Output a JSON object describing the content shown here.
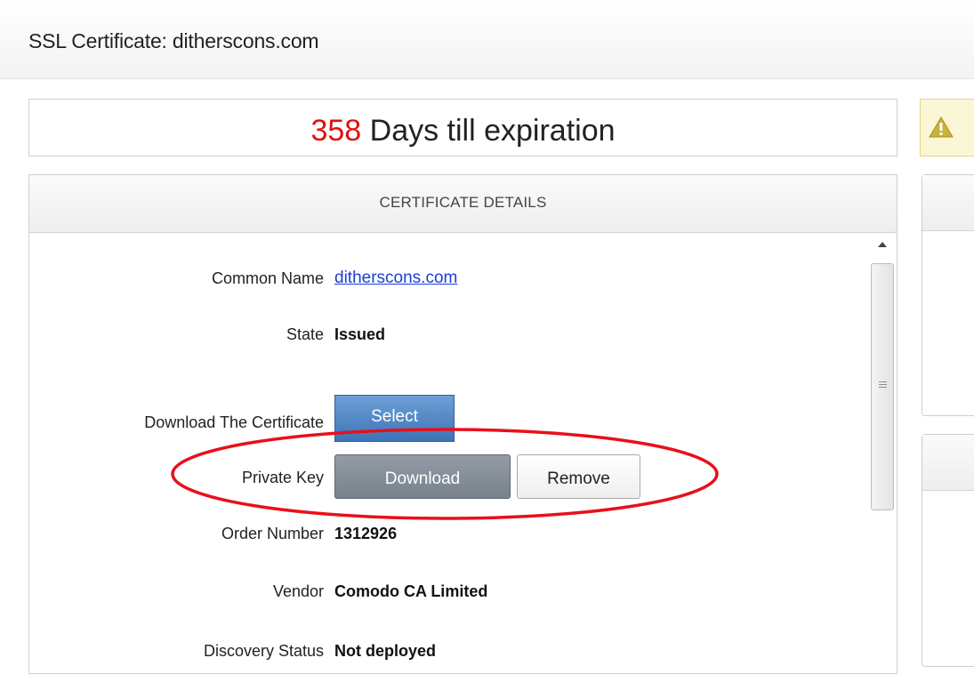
{
  "window": {
    "title": "SSL Certificate: ditherscons.com"
  },
  "expiry": {
    "days": "358",
    "label": " Days till expiration"
  },
  "panel": {
    "header": "CERTIFICATE DETAILS"
  },
  "fields": {
    "common_name": {
      "label": "Common Name",
      "value": "ditherscons.com"
    },
    "state": {
      "label": "State",
      "value": "Issued"
    },
    "download_certificate": {
      "label": "Download The Certificate",
      "button": "Select"
    },
    "private_key": {
      "label": "Private Key",
      "download_button": "Download",
      "remove_button": "Remove"
    },
    "order_number": {
      "label": "Order Number",
      "value": "1312926"
    },
    "vendor": {
      "label": "Vendor",
      "value": "Comodo CA Limited"
    },
    "discovery_status": {
      "label": "Discovery Status",
      "value": "Not deployed"
    }
  },
  "icons": {
    "warning": "warning-triangle-icon",
    "scroll_up": "chevron-up-icon"
  },
  "colors": {
    "days_count": "#e01010",
    "link": "#1a3ed6",
    "select_button": "#4a80c0",
    "download_button": "#858f99",
    "highlight": "#e8101a",
    "warning": "#c9b23a"
  }
}
